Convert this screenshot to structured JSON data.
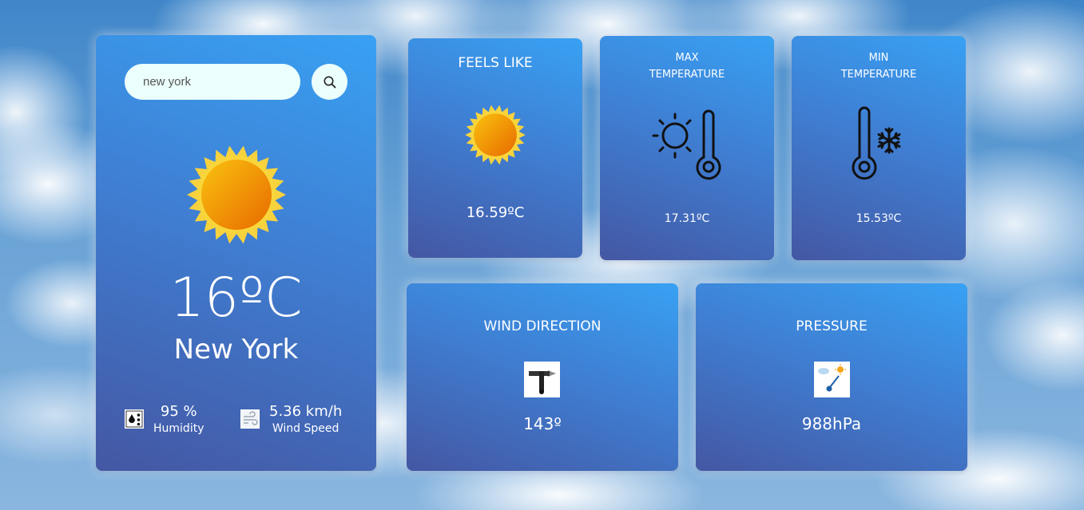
{
  "search": {
    "value": "new york",
    "button_icon": "search-icon"
  },
  "current": {
    "icon": "sun-icon",
    "temperature": "16ºC",
    "city": "New York",
    "humidity_value": "95 %",
    "humidity_label": "Humidity",
    "humidity_icon": "humidity-icon",
    "wind_value": "5.36 km/h",
    "wind_label": "Wind Speed",
    "wind_icon": "wind-icon"
  },
  "cards": {
    "feels_like": {
      "title": "FEELS LIKE",
      "value": "16.59ºC",
      "icon": "sun-icon"
    },
    "max_temp": {
      "title_line1": "MAX",
      "title_line2": "TEMPERATURE",
      "value": "17.31ºC",
      "icon": "thermometer-sun-icon"
    },
    "min_temp": {
      "title_line1": "MIN",
      "title_line2": "TEMPERATURE",
      "value": "15.53ºC",
      "icon": "thermometer-snowflake-icon"
    },
    "wind_direction": {
      "title": "WIND DIRECTION",
      "value": "143º",
      "icon": "wind-vane-icon"
    },
    "pressure": {
      "title": "PRESSURE",
      "value": "988hPa",
      "icon": "barometer-icon"
    }
  },
  "colors": {
    "card_top": "#38a1f3",
    "card_bottom": "#4457a3",
    "input_bg": "#ebfffc",
    "sun_outer": "#f9d13a",
    "sun_inner": "#f39a05"
  }
}
